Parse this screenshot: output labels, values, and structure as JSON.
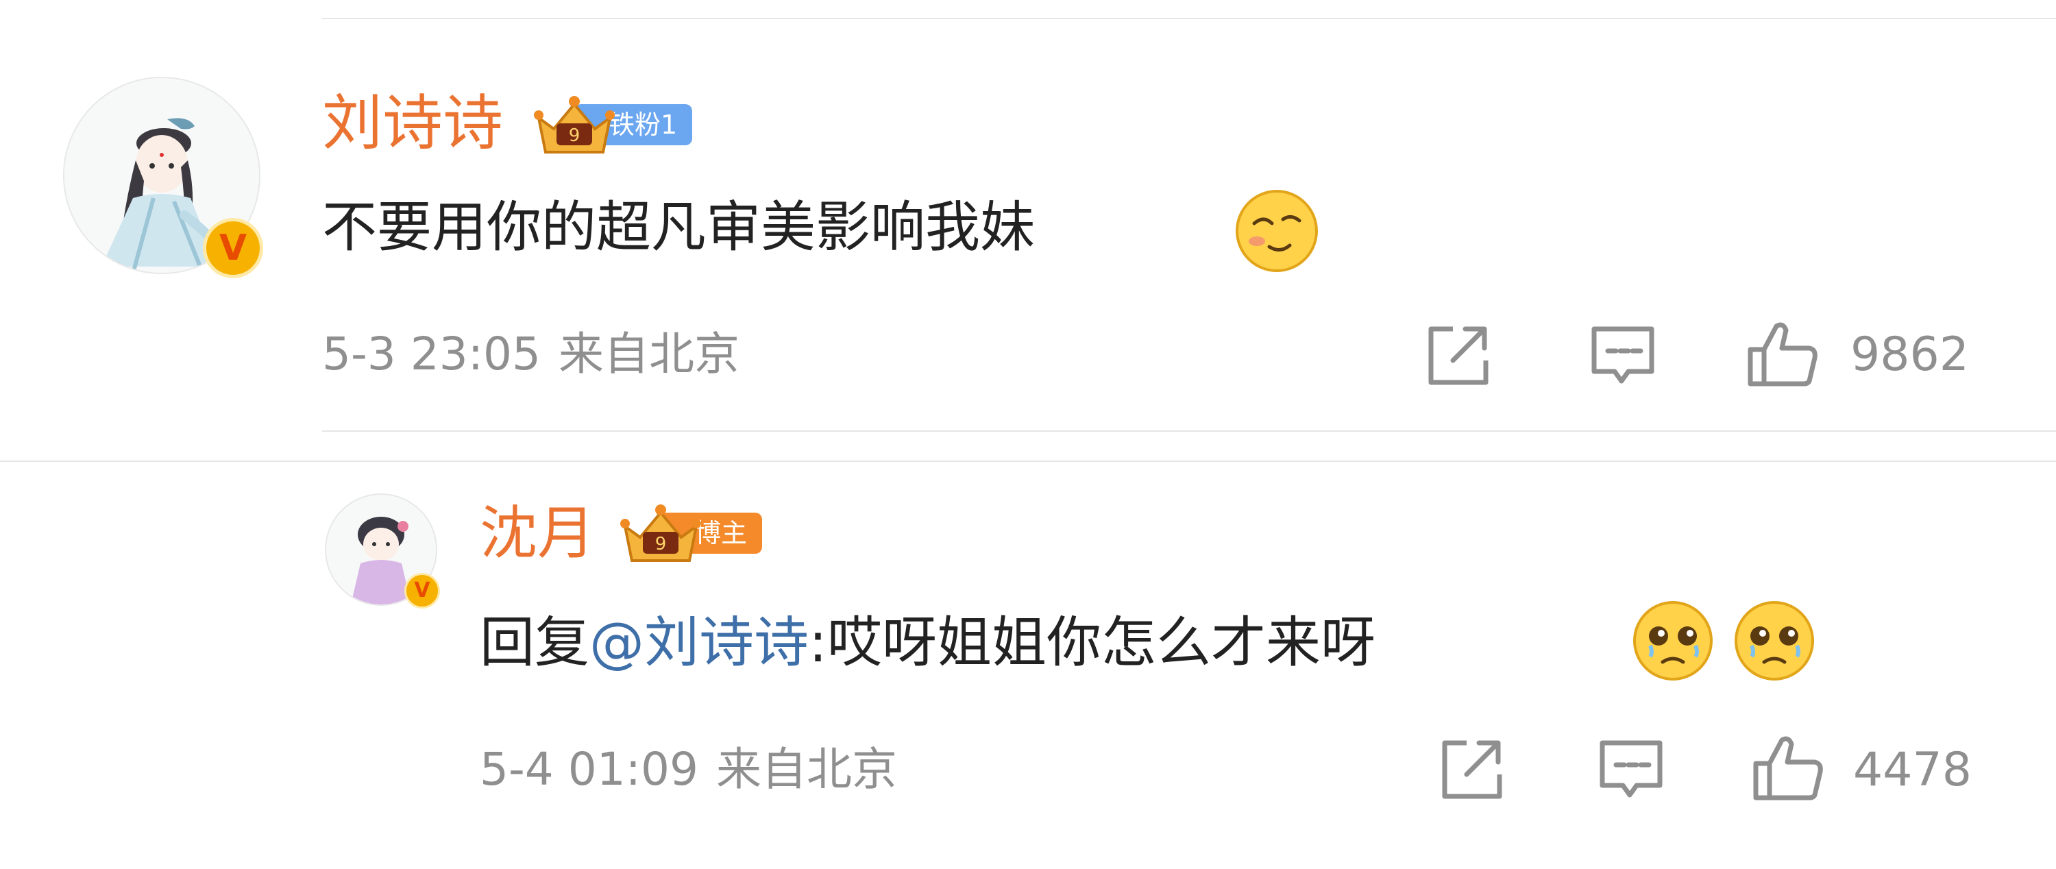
{
  "comments": [
    {
      "username": "刘诗诗",
      "badge_label": "铁粉1",
      "verified_mark": "V",
      "avatar_icon": "ink-painting-girl-avatar",
      "emoji_icon": "sly-smile-emoji",
      "text": "不要用你的超凡审美影响我妹",
      "time": "5-3 23:05",
      "location": "来自北京",
      "likes": "9862"
    },
    {
      "username": "沈月",
      "badge_label": "博主",
      "verified_mark": "V",
      "avatar_icon": "chibi-girl-avatar",
      "emoji_icon": "teary-face-emoji",
      "reply_prefix": "回复",
      "mention": "@刘诗诗",
      "text": ":哎呀姐姐你怎么才来呀",
      "time": "5-4 01:09",
      "location": "来自北京",
      "likes": "4478"
    }
  ],
  "actions": {
    "share_icon": "share-icon",
    "comment_icon": "comment-icon",
    "like_icon": "thumbs-up-icon"
  },
  "colors": {
    "username": "#eb7331",
    "mention": "#3e6fa8",
    "meta": "#8f8f8f",
    "fan_badge": "#6ba6f0",
    "blogger_badge": "#f58a2a"
  }
}
